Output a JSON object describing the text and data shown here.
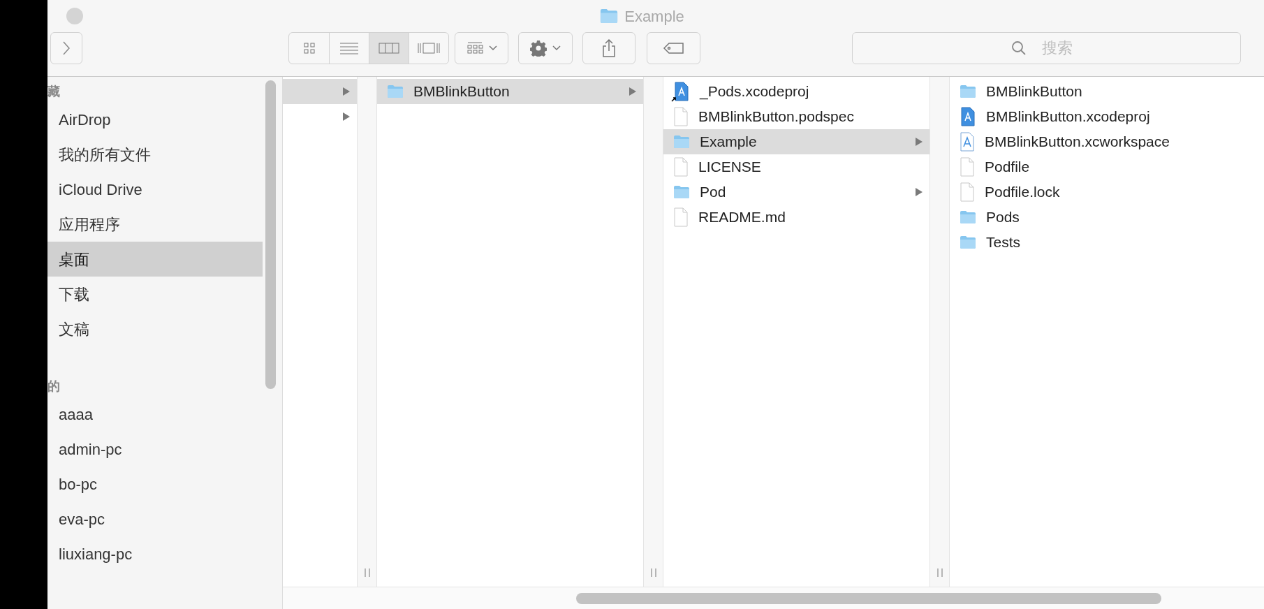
{
  "window": {
    "title": "Example"
  },
  "toolbar": {
    "view_modes": [
      {
        "kind": "icons",
        "selected": false
      },
      {
        "kind": "list",
        "selected": false
      },
      {
        "kind": "columns",
        "selected": true
      },
      {
        "kind": "gallery",
        "selected": false
      }
    ],
    "search": {
      "placeholder": "搜索"
    }
  },
  "sidebar": {
    "sections": [
      {
        "title": "藏",
        "items": [
          {
            "label": "AirDrop",
            "selected": false
          },
          {
            "label": "我的所有文件",
            "selected": false
          },
          {
            "label": "iCloud Drive",
            "selected": false
          },
          {
            "label": "应用程序",
            "selected": false
          },
          {
            "label": "桌面",
            "selected": true
          },
          {
            "label": "下载",
            "selected": false
          },
          {
            "label": "文稿",
            "selected": false
          }
        ]
      },
      {
        "title": "的",
        "items": [
          {
            "label": "aaaa",
            "selected": false
          },
          {
            "label": "admin-pc",
            "selected": false
          },
          {
            "label": "bo-pc",
            "selected": false
          },
          {
            "label": "eva-pc",
            "selected": false
          },
          {
            "label": "liuxiang-pc",
            "selected": false
          }
        ]
      }
    ]
  },
  "columns": [
    {
      "rows": [
        {
          "selected": true,
          "has_children": true
        },
        {
          "selected": false,
          "has_children": true
        }
      ]
    },
    {
      "rows": [
        {
          "name": "BMBlinkButton",
          "kind": "folder",
          "alias": false,
          "selected": true,
          "has_children": true
        }
      ]
    },
    {
      "rows": [
        {
          "name": "_Pods.xcodeproj",
          "kind": "xcodeproj",
          "alias": true,
          "selected": false,
          "has_children": false
        },
        {
          "name": "BMBlinkButton.podspec",
          "kind": "file",
          "alias": false,
          "selected": false,
          "has_children": false
        },
        {
          "name": "Example",
          "kind": "folder",
          "alias": false,
          "selected": true,
          "has_children": true
        },
        {
          "name": "LICENSE",
          "kind": "file",
          "alias": false,
          "selected": false,
          "has_children": false
        },
        {
          "name": "Pod",
          "kind": "folder",
          "alias": false,
          "selected": false,
          "has_children": true
        },
        {
          "name": "README.md",
          "kind": "file",
          "alias": false,
          "selected": false,
          "has_children": false
        }
      ]
    },
    {
      "rows": [
        {
          "name": "BMBlinkButton",
          "kind": "folder",
          "alias": false,
          "selected": false,
          "has_children": false
        },
        {
          "name": "BMBlinkButton.xcodeproj",
          "kind": "xcodeproj",
          "alias": false,
          "selected": false,
          "has_children": false
        },
        {
          "name": "BMBlinkButton.xcworkspace",
          "kind": "xcworkspace",
          "alias": false,
          "selected": false,
          "has_children": false
        },
        {
          "name": "Podfile",
          "kind": "file",
          "alias": false,
          "selected": false,
          "has_children": false
        },
        {
          "name": "Podfile.lock",
          "kind": "file",
          "alias": false,
          "selected": false,
          "has_children": false
        },
        {
          "name": "Pods",
          "kind": "folder",
          "alias": false,
          "selected": false,
          "has_children": false
        },
        {
          "name": "Tests",
          "kind": "folder",
          "alias": false,
          "selected": false,
          "has_children": false
        }
      ]
    }
  ]
}
